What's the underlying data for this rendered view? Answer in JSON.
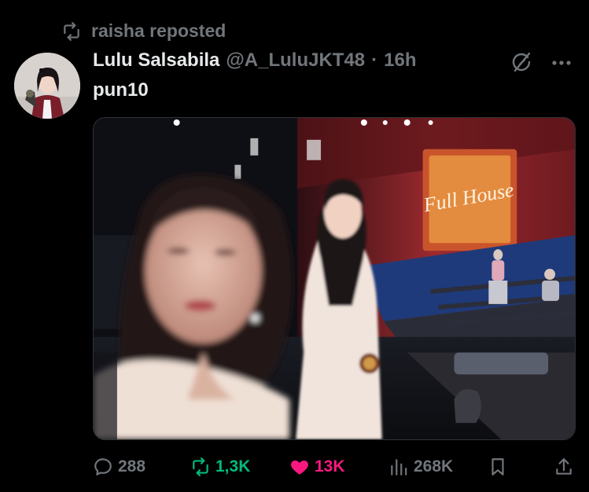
{
  "repost": {
    "icon": "repost-icon",
    "text": "raisha reposted"
  },
  "tweet": {
    "author": {
      "display_name": "Lulu Salsabila",
      "handle": "@A_LuluJKT48",
      "separator": "·",
      "time": "16h",
      "avatar": "avatar-image"
    },
    "text": "pun10",
    "media": {
      "description": "blurry selfie photo at a concert stage",
      "icon": "photo"
    },
    "menu_icons": [
      "grok-icon",
      "more-icon"
    ]
  },
  "actions": {
    "reply": {
      "icon": "reply-icon",
      "count": "288"
    },
    "repost": {
      "icon": "repost-icon",
      "count": "1,3K",
      "color": "#00ba7c"
    },
    "like": {
      "icon": "heart-icon",
      "count": "13K",
      "color": "#f91880"
    },
    "views": {
      "icon": "views-icon",
      "count": "268K"
    },
    "bookmark": {
      "icon": "bookmark-icon"
    },
    "share": {
      "icon": "share-icon"
    }
  },
  "colors": {
    "background": "#000000",
    "muted": "#71767b",
    "text": "#e7e9ea"
  }
}
